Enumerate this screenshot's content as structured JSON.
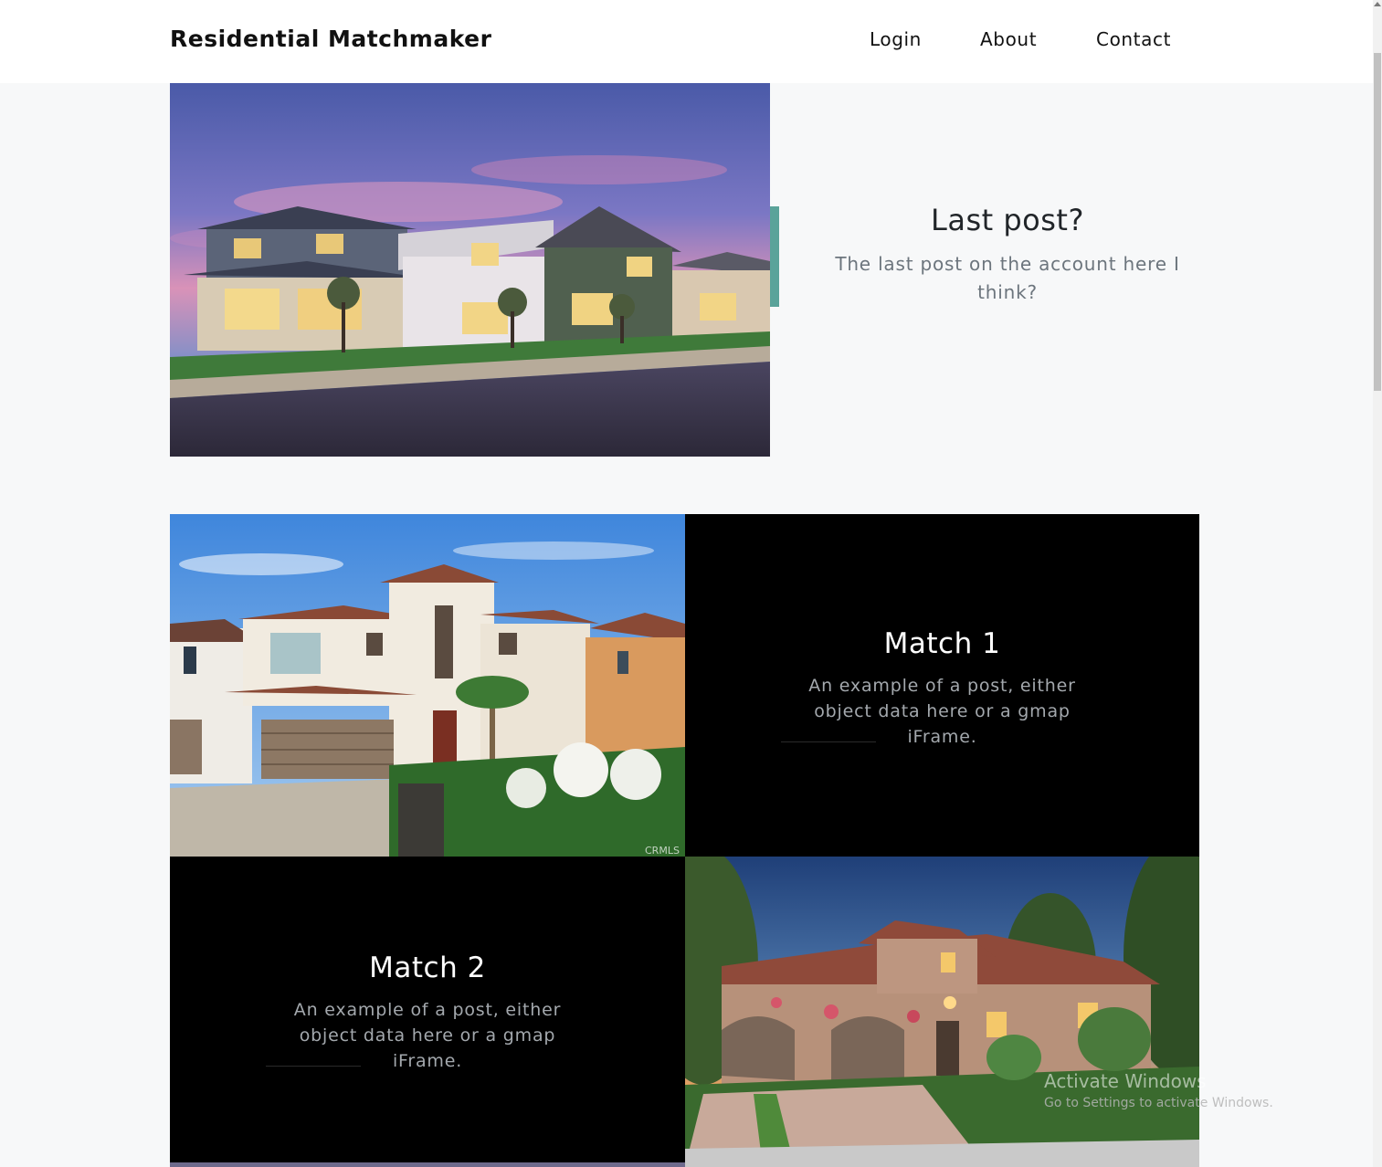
{
  "navbar": {
    "brand": "Residential Matchmaker",
    "links": {
      "login": "Login",
      "about": "About",
      "contact": "Contact"
    }
  },
  "hero": {
    "title": "Last post?",
    "description": "The last post on the account here I think?"
  },
  "matches": [
    {
      "title": "Match 1",
      "description": "An example of a post, either object data here or a gmap iFrame."
    },
    {
      "title": "Match 2",
      "description": "An example of a post, either object data here or a gmap iFrame."
    }
  ],
  "photo_credit": "CRMLS",
  "watermark": {
    "title": "Activate Windows",
    "subtitle": "Go to Settings to activate Windows."
  },
  "colors": {
    "accent": "#5aa39a",
    "page_bg": "#f7f8f9",
    "dark_cell": "#000000"
  }
}
